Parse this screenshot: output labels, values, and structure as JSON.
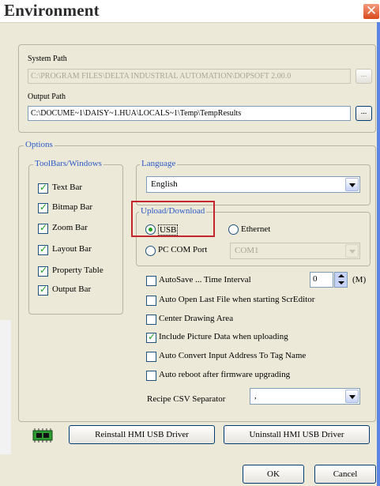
{
  "window": {
    "title": "Environment",
    "close_glyph": "✕"
  },
  "paths": {
    "system_label": "System Path",
    "system_value": "C:\\PROGRAM FILES\\DELTA INDUSTRIAL AUTOMATION\\DOPSOFT 2.00.0",
    "output_label": "Output Path",
    "output_value": "C:\\DOCUME~1\\DAISY~1.HUA\\LOCALS~1\\Temp\\TempResults",
    "browse_label": "..."
  },
  "options": {
    "title": "Options",
    "toolbars": {
      "title": "ToolBars/Windows",
      "items": [
        {
          "label": "Text Bar",
          "checked": true
        },
        {
          "label": "Bitmap Bar",
          "checked": true
        },
        {
          "label": "Zoom Bar",
          "checked": true
        },
        {
          "label": "Layout Bar",
          "checked": true
        },
        {
          "label": "Property Table",
          "checked": true
        },
        {
          "label": "Output Bar",
          "checked": true
        }
      ]
    },
    "language": {
      "title": "Language",
      "value": "English"
    },
    "upload": {
      "title": "Upload/Download",
      "usb_label": "USB",
      "ethernet_label": "Ethernet",
      "pc_com_label": "PC COM Port",
      "com_value": "COM1",
      "selected": "USB"
    },
    "autosave": {
      "label": "AutoSave ...  Time Interval",
      "value": "0",
      "unit": "(M)",
      "checked": false
    },
    "flags": [
      {
        "label": "Auto Open Last File when starting ScrEditor",
        "checked": false
      },
      {
        "label": "Center Drawing Area",
        "checked": false
      },
      {
        "label": "Include Picture Data when uploading",
        "checked": true
      },
      {
        "label": "Auto Convert Input Address To Tag Name",
        "checked": false
      },
      {
        "label": "Auto reboot after firmware upgrading",
        "checked": false
      }
    ],
    "recipe": {
      "label": "Recipe CSV Separator",
      "value": ","
    }
  },
  "usb_driver": {
    "reinstall_label": "Reinstall HMI USB Driver",
    "uninstall_label": "Uninstall HMI USB Driver"
  },
  "footer": {
    "ok_label": "OK",
    "cancel_label": "Cancel"
  },
  "colors": {
    "group_title": "#2b58c8",
    "highlight": "#c4262e",
    "check": "#21a121"
  }
}
